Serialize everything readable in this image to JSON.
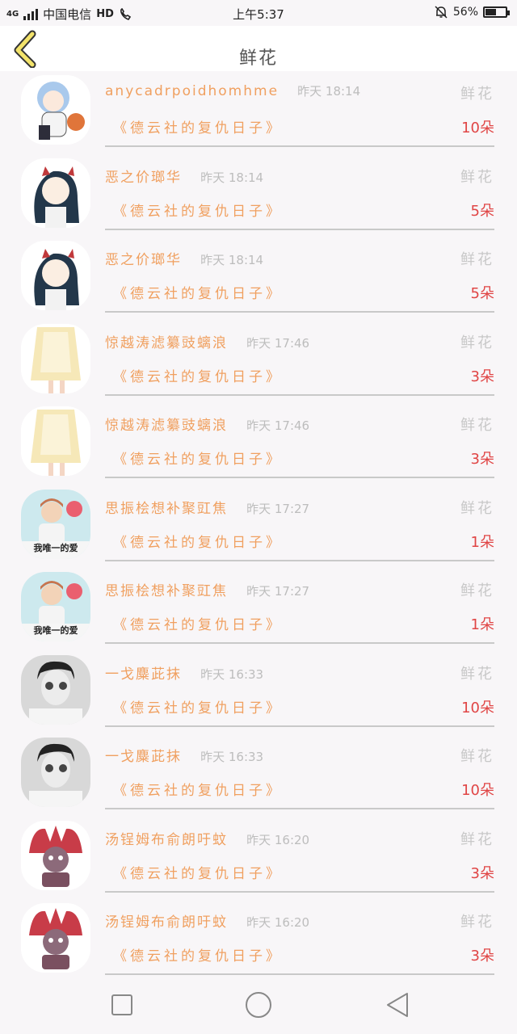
{
  "status_bar": {
    "network": "4G",
    "carrier": "中国电信",
    "hd": "HD",
    "time": "上午5:37",
    "battery_percent": "56%",
    "battery_level": 0.56
  },
  "header": {
    "title": "鲜花",
    "back_icon": "chevron-left-icon"
  },
  "colors": {
    "accent_orange": "#f0a060",
    "count_red": "#e04545",
    "back_yellow": "#f3e36b"
  },
  "rows": [
    {
      "user": "anycadrpoidhomhme",
      "time": "昨天 18:14",
      "gift": "鲜花",
      "book": "《德云社的复仇日子》",
      "count": "10朵",
      "avatar": "anime-boy-avatar"
    },
    {
      "user": "恶之价瑯华",
      "time": "昨天 18:14",
      "gift": "鲜花",
      "book": "《德云社的复仇日子》",
      "count": "5朵",
      "avatar": "anime-girl-horns-avatar"
    },
    {
      "user": "恶之价瑯华",
      "time": "昨天 18:14",
      "gift": "鲜花",
      "book": "《德云社的复仇日子》",
      "count": "5朵",
      "avatar": "anime-girl-horns-avatar"
    },
    {
      "user": "惊越涛滤纂豉螭浪",
      "time": "昨天 17:46",
      "gift": "鲜花",
      "book": "《德云社的复仇日子》",
      "count": "3朵",
      "avatar": "dress-girl-avatar"
    },
    {
      "user": "惊越涛滤纂豉螭浪",
      "time": "昨天 17:46",
      "gift": "鲜花",
      "book": "《德云社的复仇日子》",
      "count": "3朵",
      "avatar": "dress-girl-avatar"
    },
    {
      "user": "思振桧想补聚豇焦",
      "time": "昨天 17:27",
      "gift": "鲜花",
      "book": "《德云社的复仇日子》",
      "count": "1朵",
      "avatar": "my-only-love-avatar",
      "avatar_caption": "我唯一的爱"
    },
    {
      "user": "思振桧想补聚豇焦",
      "time": "昨天 17:27",
      "gift": "鲜花",
      "book": "《德云社的复仇日子》",
      "count": "1朵",
      "avatar": "my-only-love-avatar",
      "avatar_caption": "我唯一的爱"
    },
    {
      "user": "一戈麋茈抹",
      "time": "昨天 16:33",
      "gift": "鲜花",
      "book": "《德云社的复仇日子》",
      "count": "10朵",
      "avatar": "bw-boy-avatar"
    },
    {
      "user": "一戈麋茈抹",
      "time": "昨天 16:33",
      "gift": "鲜花",
      "book": "《德云社的复仇日子》",
      "count": "10朵",
      "avatar": "bw-boy-avatar"
    },
    {
      "user": "汤锃姆布俞朗吁蚊",
      "time": "昨天 16:20",
      "gift": "鲜花",
      "book": "《德云社的复仇日子》",
      "count": "3朵",
      "avatar": "cartoon-warrior-avatar"
    },
    {
      "user": "汤锃姆布俞朗吁蚊",
      "time": "昨天 16:20",
      "gift": "鲜花",
      "book": "《德云社的复仇日子》",
      "count": "3朵",
      "avatar": "cartoon-warrior-avatar"
    }
  ],
  "nav": {
    "recent_icon": "square-icon",
    "home_icon": "circle-icon",
    "back_icon": "triangle-back-icon"
  }
}
